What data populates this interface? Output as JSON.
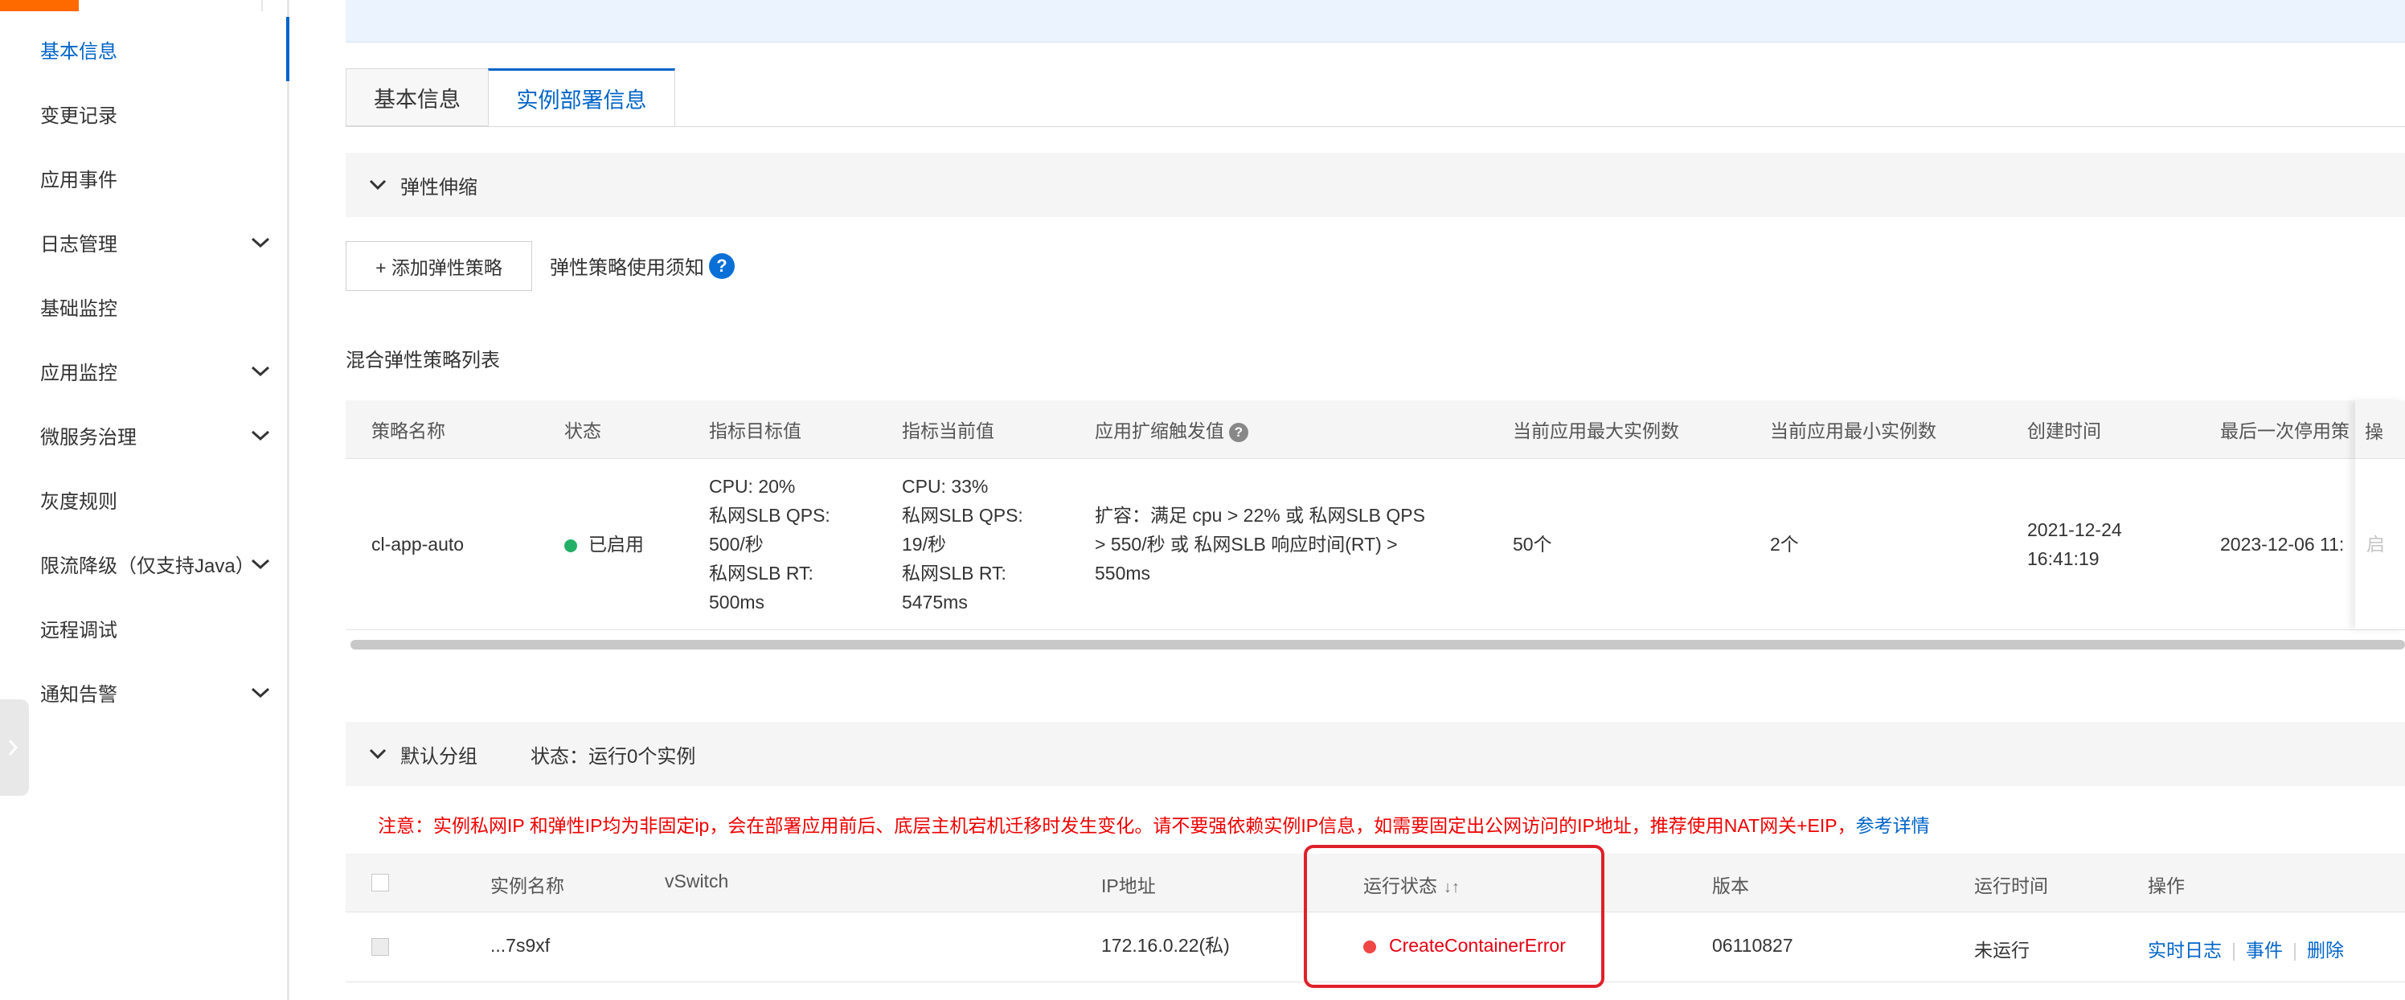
{
  "sidebar": {
    "items": [
      {
        "label": "基本信息",
        "active": true,
        "expandable": false
      },
      {
        "label": "变更记录",
        "active": false,
        "expandable": false
      },
      {
        "label": "应用事件",
        "active": false,
        "expandable": false
      },
      {
        "label": "日志管理",
        "active": false,
        "expandable": true
      },
      {
        "label": "基础监控",
        "active": false,
        "expandable": false
      },
      {
        "label": "应用监控",
        "active": false,
        "expandable": true
      },
      {
        "label": "微服务治理",
        "active": false,
        "expandable": true
      },
      {
        "label": "灰度规则",
        "active": false,
        "expandable": false
      },
      {
        "label": "限流降级（仅支持Java）",
        "active": false,
        "expandable": true
      },
      {
        "label": "远程调试",
        "active": false,
        "expandable": false
      },
      {
        "label": "通知告警",
        "active": false,
        "expandable": true
      }
    ]
  },
  "tabs": [
    {
      "label": "基本信息",
      "active": false
    },
    {
      "label": "实例部署信息",
      "active": true
    }
  ],
  "elastic": {
    "section_title": "弹性伸缩",
    "add_button": "+ 添加弹性策略",
    "policy_notice": "弹性策略使用须知",
    "help_glyph": "?",
    "list_title": "混合弹性策略列表",
    "headers": [
      "策略名称",
      "状态",
      "指标目标值",
      "指标当前值",
      "应用扩缩触发值",
      "当前应用最大实例数",
      "当前应用最小实例数",
      "创建时间",
      "最后一次停用策",
      "操"
    ],
    "row": {
      "name": "cl-app-auto",
      "status": "已启用",
      "target": [
        "CPU: 20%",
        "私网SLB QPS:",
        "500/秒",
        "私网SLB RT:",
        "500ms"
      ],
      "current": [
        "CPU: 33%",
        "私网SLB QPS:",
        "19/秒",
        "私网SLB RT:",
        "5475ms"
      ],
      "trigger": [
        "扩容：满足 cpu > 22% 或 私网SLB QPS",
        "> 550/秒 或 私网SLB 响应时间(RT) >",
        "550ms"
      ],
      "max_instances": "50个",
      "min_instances": "2个",
      "created": [
        "2021-12-24",
        "16:41:19"
      ],
      "last_disabled": "2023-12-06 11:",
      "action_partial": "启"
    }
  },
  "group": {
    "section_title": "默认分组",
    "status_text": "状态：运行0个实例",
    "warning_text": "注意：实例私网IP 和弹性IP均为非固定ip，会在部署应用前后、底层主机宕机迁移时发生变化。请不要强依赖实例IP信息，如需要固定出公网访问的IP地址，推荐使用NAT网关+EIP，",
    "warning_link": "参考详情",
    "headers": [
      "实例名称",
      "vSwitch",
      "IP地址",
      "运行状态",
      "版本",
      "运行时间",
      "操作"
    ],
    "sort_glyph": "↓↑",
    "row": {
      "name": "...7s9xf",
      "vswitch": "",
      "ip": "172.16.0.22(私)",
      "status": "CreateContainerError",
      "version": "06110827",
      "runtime": "未运行",
      "actions": [
        "实时日志",
        "事件",
        "删除"
      ]
    }
  },
  "colors": {
    "accent": "#0064c8",
    "brand": "#ff6a00",
    "error": "#e60012",
    "success": "#23b066",
    "highlight": "#e0202a"
  }
}
